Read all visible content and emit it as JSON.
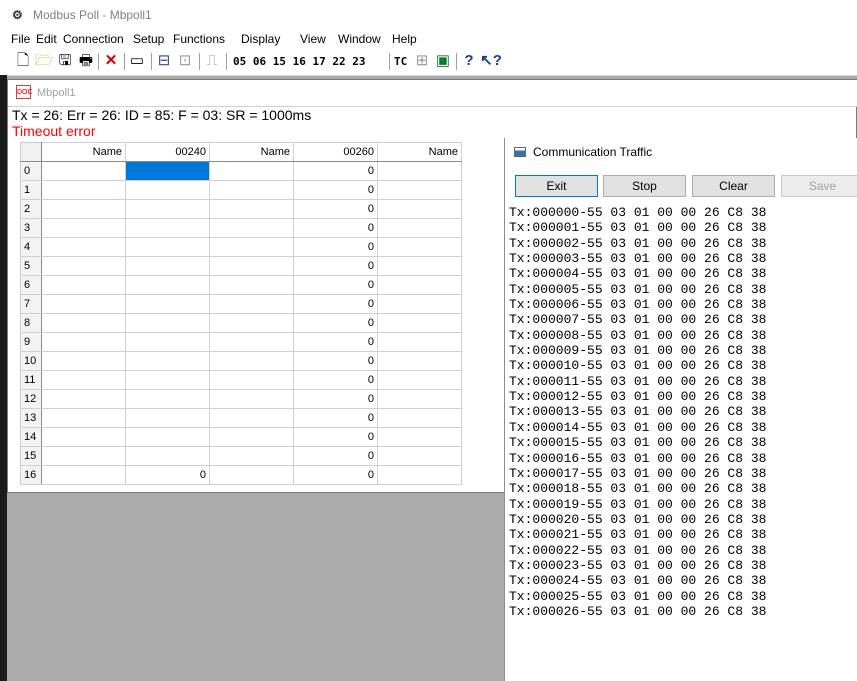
{
  "window": {
    "title": "Modbus Poll - Mbpoll1"
  },
  "menu": [
    "File",
    "Edit",
    "Connection",
    "Setup",
    "Functions",
    "Display",
    "View",
    "Window",
    "Help"
  ],
  "toolbar": {
    "function_codes": "05 06 15 16 17 22 23",
    "tc_label": "TC"
  },
  "document": {
    "title": "Mbpoll1",
    "status": "Tx = 26: Err = 26: ID = 85: F = 03: SR = 1000ms",
    "error": "Timeout error",
    "columns": [
      "Name",
      "00240",
      "Name",
      "00260",
      "Name"
    ],
    "rows": [
      {
        "num": "0",
        "c1": "",
        "c3": "0"
      },
      {
        "num": "1",
        "c1": "",
        "c3": "0"
      },
      {
        "num": "2",
        "c1": "",
        "c3": "0"
      },
      {
        "num": "3",
        "c1": "",
        "c3": "0"
      },
      {
        "num": "4",
        "c1": "",
        "c3": "0"
      },
      {
        "num": "5",
        "c1": "",
        "c3": "0"
      },
      {
        "num": "6",
        "c1": "",
        "c3": "0"
      },
      {
        "num": "7",
        "c1": "",
        "c3": "0"
      },
      {
        "num": "8",
        "c1": "",
        "c3": "0"
      },
      {
        "num": "9",
        "c1": "",
        "c3": "0"
      },
      {
        "num": "10",
        "c1": "",
        "c3": "0"
      },
      {
        "num": "11",
        "c1": "",
        "c3": "0"
      },
      {
        "num": "12",
        "c1": "",
        "c3": "0"
      },
      {
        "num": "13",
        "c1": "",
        "c3": "0"
      },
      {
        "num": "14",
        "c1": "",
        "c3": "0"
      },
      {
        "num": "15",
        "c1": "",
        "c3": "0"
      },
      {
        "num": "16",
        "c1": "0",
        "c3": "0"
      }
    ]
  },
  "traffic": {
    "title": "Communication Traffic",
    "buttons": {
      "exit": "Exit",
      "stop": "Stop",
      "clear": "Clear",
      "save": "Save"
    },
    "lines": [
      "Tx:000000-55 03 01 00 00 26 C8 38",
      "Tx:000001-55 03 01 00 00 26 C8 38",
      "Tx:000002-55 03 01 00 00 26 C8 38",
      "Tx:000003-55 03 01 00 00 26 C8 38",
      "Tx:000004-55 03 01 00 00 26 C8 38",
      "Tx:000005-55 03 01 00 00 26 C8 38",
      "Tx:000006-55 03 01 00 00 26 C8 38",
      "Tx:000007-55 03 01 00 00 26 C8 38",
      "Tx:000008-55 03 01 00 00 26 C8 38",
      "Tx:000009-55 03 01 00 00 26 C8 38",
      "Tx:000010-55 03 01 00 00 26 C8 38",
      "Tx:000011-55 03 01 00 00 26 C8 38",
      "Tx:000012-55 03 01 00 00 26 C8 38",
      "Tx:000013-55 03 01 00 00 26 C8 38",
      "Tx:000014-55 03 01 00 00 26 C8 38",
      "Tx:000015-55 03 01 00 00 26 C8 38",
      "Tx:000016-55 03 01 00 00 26 C8 38",
      "Tx:000017-55 03 01 00 00 26 C8 38",
      "Tx:000018-55 03 01 00 00 26 C8 38",
      "Tx:000019-55 03 01 00 00 26 C8 38",
      "Tx:000020-55 03 01 00 00 26 C8 38",
      "Tx:000021-55 03 01 00 00 26 C8 38",
      "Tx:000022-55 03 01 00 00 26 C8 38",
      "Tx:000023-55 03 01 00 00 26 C8 38",
      "Tx:000024-55 03 01 00 00 26 C8 38",
      "Tx:000025-55 03 01 00 00 26 C8 38",
      "Tx:000026-55 03 01 00 00 26 C8 38"
    ]
  }
}
